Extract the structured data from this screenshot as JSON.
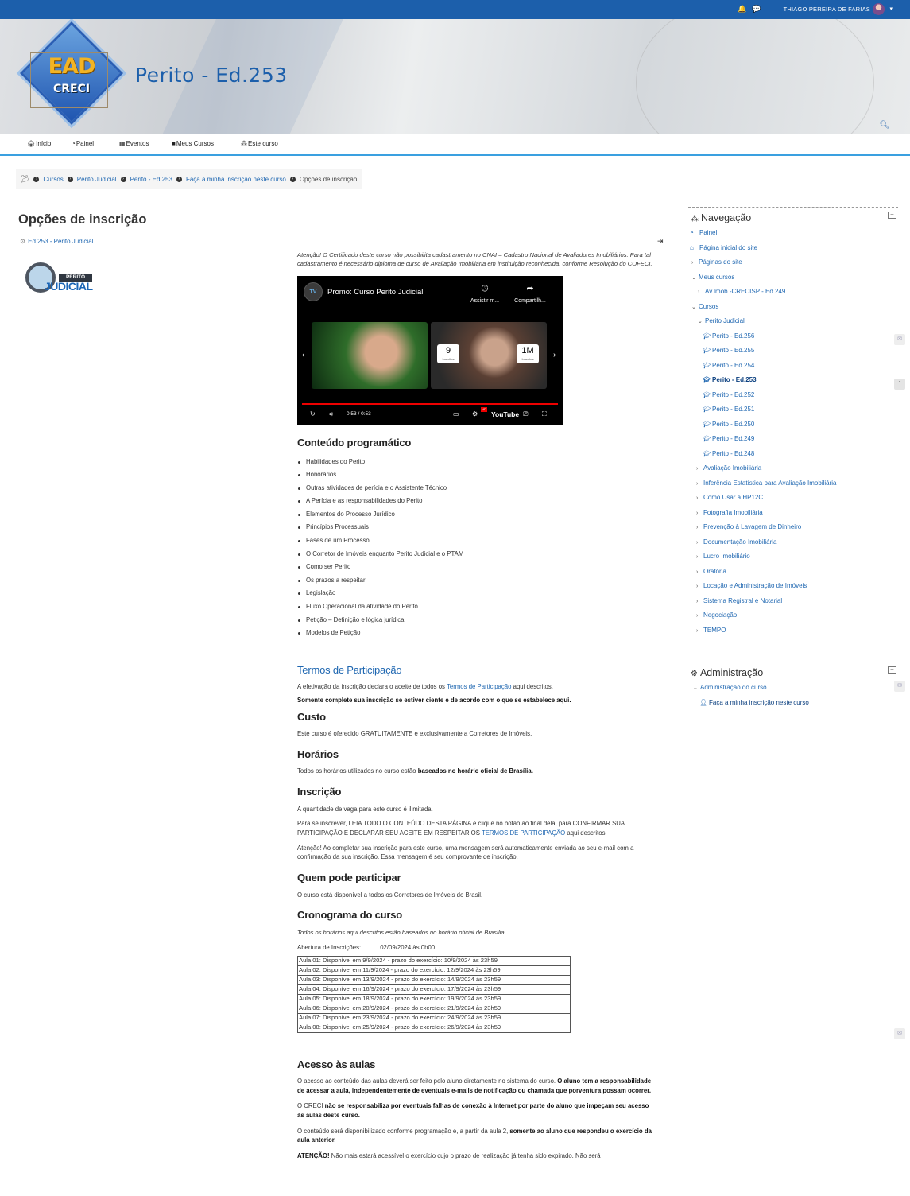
{
  "topbar": {
    "user_name": "THIAGO PEREIRA DE FARIAS",
    "bell_icon": "bell-icon",
    "chat_icon": "chat-icon",
    "caret": "▾"
  },
  "header": {
    "logo_top": "EAD",
    "logo_bottom": "CRECI",
    "site_title": "Perito - Ed.253"
  },
  "nav": {
    "items": [
      {
        "icon": "home-icon",
        "label": "Início"
      },
      {
        "icon": "dashboard-icon",
        "label": "Painel"
      },
      {
        "icon": "calendar-icon",
        "label": "Eventos"
      },
      {
        "icon": "briefcase-icon",
        "label": "Meus Cursos"
      },
      {
        "icon": "sitemap-icon",
        "label": "Este curso"
      }
    ]
  },
  "breadcrumb": [
    "Cursos",
    "Perito Judicial",
    "Perito - Ed.253",
    "Faça a minha inscrição neste curso",
    "Opções de inscrição"
  ],
  "page": {
    "title": "Opções de inscrição",
    "course_link": "Ed.253 - Perito Judicial",
    "course_image": {
      "tag": "PERITO",
      "word": "JUDICIAL"
    },
    "notice": "Atenção! O Certificado deste curso não possibilita cadastramento no CNAI – Cadastro Nacional de Avaliadores Imobiliários. Para tal cadastramento é necessário diploma de curso de Avaliação Imobiliária em instituição reconhecida, conforme Resolução do COFECI.",
    "video": {
      "channel": "TV",
      "title": "Promo: Curso Perito Judicial",
      "watch_later": "Assistir m...",
      "share": "Compartilh...",
      "card1": "9",
      "card1_sub": "Inscritos",
      "card2": "1M",
      "card2_sub": "Inscritos",
      "time": "0:53 / 0:53",
      "brand": "YouTube",
      "hd": "HD"
    },
    "program_title": "Conteúdo programático",
    "program": [
      "Habilidades do Perito",
      "Honorários",
      "Outras atividades de perícia e o Assistente Técnico",
      "A Perícia e as responsabilidades do Perito",
      "Elementos do Processo Jurídico",
      "Princípios Processuais",
      "Fases de um Processo",
      "O Corretor de Imóveis enquanto Perito Judicial e o PTAM",
      "Como ser Perito",
      "Os prazos a respeitar",
      "Legislação",
      "Fluxo Operacional da atividade do Perito",
      "Petição – Definição e lógica jurídica",
      "Modelos de Petição"
    ],
    "terms_title": "Termos de Participação",
    "terms_p1_a": "A efetivação da inscrição declara o aceite de todos os ",
    "terms_link": "Termos de Participação",
    "terms_p1_b": " aqui descritos.",
    "terms_p2": "Somente complete sua inscrição se estiver ciente e de acordo com o que se estabelece aqui.",
    "cost_title": "Custo",
    "cost_p": "Este curso é oferecido GRATUITAMENTE e exclusivamente a Corretores de Imóveis.",
    "hours_title": "Horários",
    "hours_p_a": "Todos os horários utilizados no curso estão ",
    "hours_p_b": "baseados no horário oficial de Brasília.",
    "enrol_title": "Inscrição",
    "enrol_p1": "A quantidade de vaga para este curso é ilimitada.",
    "enrol_p2_a": "Para se inscrever, LEIA TODO O CONTEÚDO DESTA PÁGINA e clique no botão ao final dela, para CONFIRMAR SUA PARTICIPAÇÃO E DECLARAR SEU ACEITE EM RESPEITAR OS ",
    "enrol_p2_link": "TERMOS DE PARTICIPAÇÃO",
    "enrol_p2_b": " aqui descritos.",
    "enrol_p3": "Atenção! Ao completar sua inscrição para este curso, uma mensagem será automaticamente enviada ao seu e-mail com a confirmação da sua inscrição. Essa mensagem é seu comprovante de inscrição.",
    "who_title": "Quem pode participar",
    "who_p": "O curso está disponível a todos os Corretores de Imóveis do Brasil.",
    "sched_title": "Cronograma do curso",
    "sched_note": "Todos os horários aqui descritos estão baseados no horário oficial de Brasília.",
    "sched_open_label": "Abertura de Inscrições:",
    "sched_open_value": "02/09/2024 às 0h00",
    "sched_rows": [
      "Aula 01: Disponível em 9/9/2024 - prazo do exercício: 10/9/2024 às 23h59",
      "Aula 02: Disponível em 11/9/2024 - prazo do exercício: 12/9/2024 às 23h59",
      "Aula 03: Disponível em 13/9/2024 - prazo do exercício: 14/9/2024 às 23h59",
      "Aula 04: Disponível em 16/9/2024 - prazo do exercício: 17/9/2024 às 23h59",
      "Aula 05: Disponível em 18/9/2024 - prazo do exercício: 19/9/2024 às 23h59",
      "Aula 06: Disponível em 20/9/2024 - prazo do exercício: 21/9/2024 às 23h59",
      "Aula 07: Disponível em 23/9/2024 - prazo do exercício: 24/9/2024 às 23h59",
      "Aula 08: Disponível em 25/9/2024 - prazo do exercício: 26/9/2024 às 23h59"
    ],
    "access_title": "Acesso às aulas",
    "access_p1_a": "O acesso ao conteúdo das aulas deverá ser feito pelo aluno diretamente no sistema do curso. ",
    "access_p1_b": "O aluno tem a responsabilidade de acessar a aula, independentemente de eventuais e-mails de notificação ou chamada que porventura possam ocorrer.",
    "access_p2_a": "O CRECI ",
    "access_p2_b": "não se responsabiliza por eventuais falhas de conexão à Internet por parte do aluno que impeçam seu acesso às aulas deste curso.",
    "access_p3_a": "O conteúdo será disponibilizado conforme programação e, a partir da aula 2, ",
    "access_p3_b": "somente ao aluno que respondeu o exercício da aula anterior.",
    "access_p4_a": "ATENÇÃO! ",
    "access_p4_b": "Não mais estará acessível o exercício cujo o prazo de realização já tenha sido expirado. Não será"
  },
  "nav_block": {
    "title": "Navegação",
    "items": [
      {
        "label": "Painel",
        "arrow": "",
        "icon": "dashboard-icon",
        "cur": false
      },
      {
        "label": "Página inicial do site",
        "arrow": "",
        "icon": "home-icon",
        "cur": false
      },
      {
        "label": "Páginas do site",
        "arrow": "›",
        "icon": "",
        "cur": false
      },
      {
        "label": "Meus cursos",
        "arrow": "⌄",
        "icon": "",
        "cur": false
      },
      {
        "label": "Av.Imob.-CRECISP - Ed.249",
        "arrow": "›",
        "icon": "",
        "cur": false
      },
      {
        "label": "Cursos",
        "arrow": "⌄",
        "icon": "",
        "cur": false
      },
      {
        "label": "Perito Judicial",
        "arrow": "⌄",
        "icon": "",
        "cur": false
      },
      {
        "label": "Perito - Ed.256",
        "arrow": "",
        "icon": "graduation-cap-icon",
        "cur": false
      },
      {
        "label": "Perito - Ed.255",
        "arrow": "",
        "icon": "graduation-cap-icon",
        "cur": false
      },
      {
        "label": "Perito - Ed.254",
        "arrow": "",
        "icon": "graduation-cap-icon",
        "cur": false
      },
      {
        "label": "Perito - Ed.253",
        "arrow": "",
        "icon": "graduation-cap-icon",
        "cur": true
      },
      {
        "label": "Perito - Ed.252",
        "arrow": "",
        "icon": "graduation-cap-icon",
        "cur": false
      },
      {
        "label": "Perito - Ed.251",
        "arrow": "",
        "icon": "graduation-cap-icon",
        "cur": false
      },
      {
        "label": "Perito - Ed.250",
        "arrow": "",
        "icon": "graduation-cap-icon",
        "cur": false
      },
      {
        "label": "Perito - Ed.249",
        "arrow": "",
        "icon": "graduation-cap-icon",
        "cur": false
      },
      {
        "label": "Perito - Ed.248",
        "arrow": "",
        "icon": "graduation-cap-icon",
        "cur": false
      },
      {
        "label": "Avaliação Imobiliária",
        "arrow": "›",
        "icon": "",
        "cur": false
      },
      {
        "label": "Inferência Estatística para Avaliação Imobiliária",
        "arrow": "›",
        "icon": "",
        "cur": false
      },
      {
        "label": "Como Usar a HP12C",
        "arrow": "›",
        "icon": "",
        "cur": false
      },
      {
        "label": "Fotografia Imobiliária",
        "arrow": "›",
        "icon": "",
        "cur": false
      },
      {
        "label": "Prevenção à Lavagem de Dinheiro",
        "arrow": "›",
        "icon": "",
        "cur": false
      },
      {
        "label": "Documentação Imobiliária",
        "arrow": "›",
        "icon": "",
        "cur": false
      },
      {
        "label": "Lucro Imobiliário",
        "arrow": "›",
        "icon": "",
        "cur": false
      },
      {
        "label": "Oratória",
        "arrow": "›",
        "icon": "",
        "cur": false
      },
      {
        "label": "Locação e Administração de Imóveis",
        "arrow": "›",
        "icon": "",
        "cur": false
      },
      {
        "label": "Sistema Registral e Notarial",
        "arrow": "›",
        "icon": "",
        "cur": false
      },
      {
        "label": "Negociação",
        "arrow": "›",
        "icon": "",
        "cur": false
      },
      {
        "label": "TEMPO",
        "arrow": "›",
        "icon": "",
        "cur": false
      }
    ]
  },
  "admin_block": {
    "title": "Administração",
    "course_admin": "Administração do curso",
    "enrol_me": "Faça a minha inscrição neste curso"
  },
  "colors": {
    "brand_blue": "#1c5fab",
    "link": "#1f67b1",
    "accent_line": "#3aa0e0"
  }
}
